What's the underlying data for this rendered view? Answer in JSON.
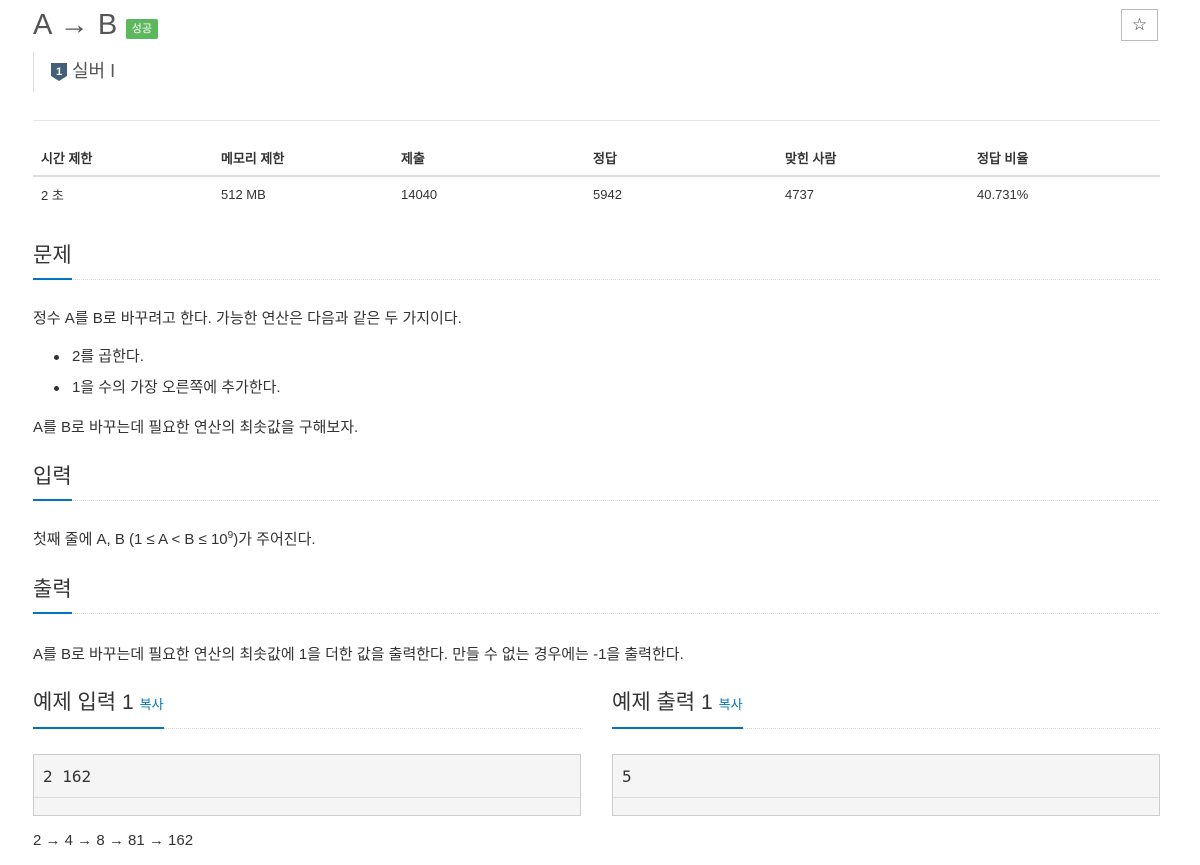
{
  "header": {
    "title": "A → B",
    "status_badge": "성공",
    "star_icon": "☆",
    "tier_icon": "silver-tier-1-icon",
    "tier_number": "1",
    "tier_label": "실버 I",
    "tier_color": "#435f7a"
  },
  "stats": {
    "headers": [
      "시간 제한",
      "메모리 제한",
      "제출",
      "정답",
      "맞힌 사람",
      "정답 비율"
    ],
    "values": [
      "2 초",
      "512 MB",
      "14040",
      "5942",
      "4737",
      "40.731%"
    ]
  },
  "problem": {
    "title": "문제",
    "intro": "정수 A를 B로 바꾸려고 한다. 가능한 연산은 다음과 같은 두 가지이다.",
    "operations": [
      "2를 곱한다.",
      "1을 수의 가장 오른쪽에 추가한다."
    ],
    "goal": "A를 B로 바꾸는데 필요한 연산의 최솟값을 구해보자."
  },
  "input": {
    "title": "입력",
    "text_before": "첫째 줄에 A, B (1 ≤ A < B ≤ 10",
    "exponent": "9",
    "text_after": ")가 주어진다."
  },
  "output": {
    "title": "출력",
    "text": "A를 B로 바꾸는데 필요한 연산의 최솟값에 1을 더한 값을 출력한다. 만들 수 없는 경우에는 -1을 출력한다."
  },
  "samples": {
    "input_title": "예제 입력 1",
    "output_title": "예제 출력 1",
    "copy_label": "복사",
    "input_value": "2 162",
    "output_value": "5",
    "explanation": "2 → 4 → 8 → 81 → 162"
  },
  "colors": {
    "accent": "#0076c0",
    "success": "#5cb85c"
  }
}
